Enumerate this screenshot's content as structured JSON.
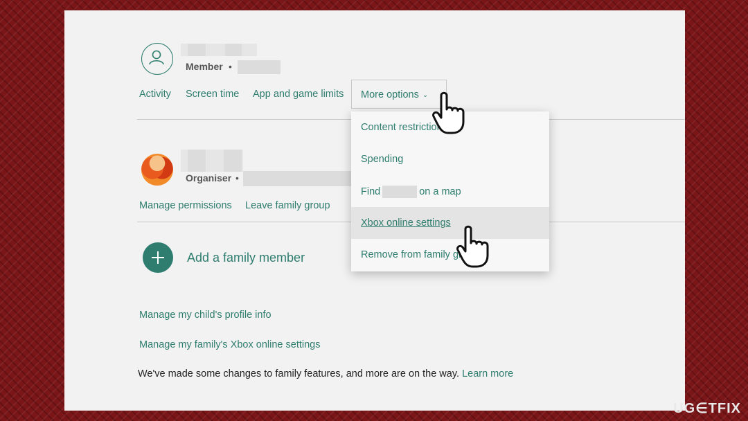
{
  "member": {
    "role_label": "Member",
    "bullet": "•"
  },
  "tabs": [
    {
      "label": "Activity"
    },
    {
      "label": "Screen time"
    },
    {
      "label": "App and game limits"
    },
    {
      "label": "More options"
    }
  ],
  "organiser": {
    "role_label": "Organiser",
    "bullet": "•",
    "links": [
      {
        "label": "Manage permissions"
      },
      {
        "label": "Leave family group"
      }
    ]
  },
  "add_member": {
    "label": "Add a family member"
  },
  "footer_links": [
    {
      "label": "Manage my child's profile info"
    },
    {
      "label": "Manage my family's Xbox online settings"
    }
  ],
  "note": {
    "text": "We've made some changes to family features, and more are on the way.",
    "link": "Learn more"
  },
  "menu": {
    "items": [
      {
        "label": "Content restrictions"
      },
      {
        "label": "Spending"
      },
      {
        "label_prefix": "Find",
        "label_suffix": "on a map"
      },
      {
        "label": "Xbox online settings"
      },
      {
        "label": "Remove from family group"
      }
    ],
    "highlighted_index": 3
  },
  "colors": {
    "accent": "#2e7d6e",
    "background": "#7a1518",
    "panel": "#f2f2f2"
  },
  "watermark": {
    "text_a": "UG",
    "text_b": "TFIX"
  }
}
